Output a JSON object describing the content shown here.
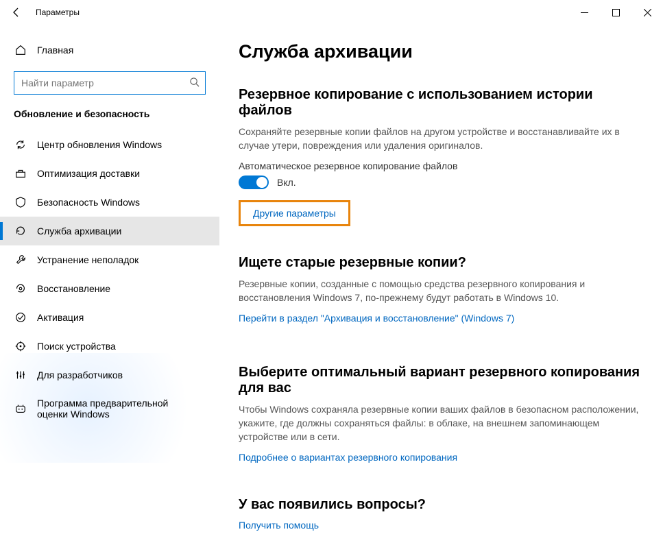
{
  "titlebar": {
    "title": "Параметры"
  },
  "sidebar": {
    "home": "Главная",
    "search_placeholder": "Найти параметр",
    "section": "Обновление и безопасность",
    "items": [
      {
        "label": "Центр обновления Windows"
      },
      {
        "label": "Оптимизация доставки"
      },
      {
        "label": "Безопасность Windows"
      },
      {
        "label": "Служба архивации"
      },
      {
        "label": "Устранение неполадок"
      },
      {
        "label": "Восстановление"
      },
      {
        "label": "Активация"
      },
      {
        "label": "Поиск устройства"
      },
      {
        "label": "Для разработчиков"
      },
      {
        "label": "Программа предварительной оценки Windows"
      }
    ]
  },
  "main": {
    "page_title": "Служба архивации",
    "sec1": {
      "heading": "Резервное копирование с использованием истории файлов",
      "desc": "Сохраняйте резервные копии файлов на другом устройстве и восстанавливайте их в случае утери, повреждения или удаления оригиналов.",
      "toggle_label": "Автоматическое резервное копирование файлов",
      "toggle_state": "Вкл.",
      "more_link": "Другие параметры"
    },
    "sec2": {
      "heading": "Ищете старые резервные копии?",
      "desc": "Резервные копии, созданные с помощью средства резервного копирования и восстановления Windows 7, по-прежнему будут работать в Windows 10.",
      "link": "Перейти в раздел \"Архивация и восстановление\" (Windows 7)"
    },
    "sec3": {
      "heading": "Выберите оптимальный вариант резервного копирования для вас",
      "desc": "Чтобы Windows сохраняла резервные копии ваших файлов в безопасном расположении, укажите, где должны сохраняться файлы: в облаке, на внешнем запоминающем устройстве или в сети.",
      "link": "Подробнее о вариантах резервного копирования"
    },
    "sec4": {
      "heading": "У вас появились вопросы?",
      "link": "Получить помощь"
    }
  }
}
